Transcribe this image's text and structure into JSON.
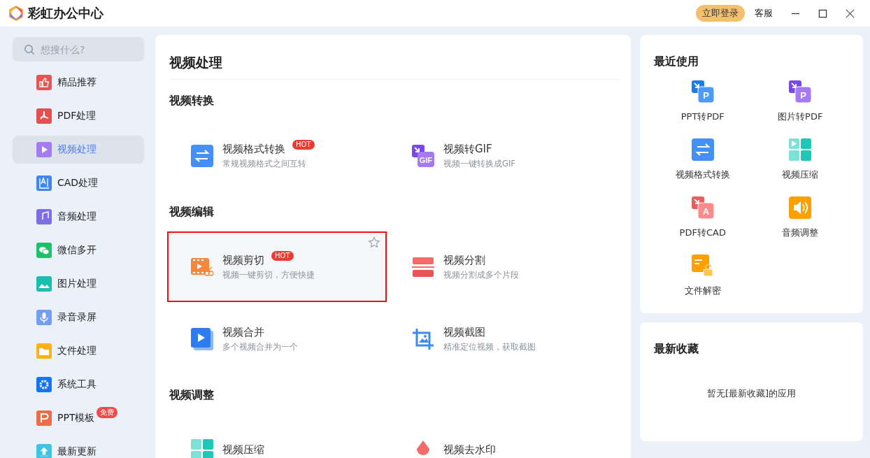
{
  "app": {
    "title": "彩虹办公中心"
  },
  "header": {
    "login": "立即登录",
    "service": "客服"
  },
  "search": {
    "placeholder": "想搜什么?"
  },
  "sidebar": {
    "items": [
      {
        "label": "精品推荐",
        "selected": false
      },
      {
        "label": "PDF处理",
        "selected": false
      },
      {
        "label": "视频处理",
        "selected": true
      },
      {
        "label": "CAD处理",
        "selected": false
      },
      {
        "label": "音频处理",
        "selected": false
      },
      {
        "label": "微信多开",
        "selected": false
      },
      {
        "label": "图片处理",
        "selected": false
      },
      {
        "label": "录音录屏",
        "selected": false
      },
      {
        "label": "文件处理",
        "selected": false
      },
      {
        "label": "系统工具",
        "selected": false
      },
      {
        "label": "PPT模板",
        "selected": false,
        "badge": "免费"
      },
      {
        "label": "最新更新",
        "selected": false
      }
    ]
  },
  "main": {
    "title": "视频处理",
    "sections": [
      {
        "title": "视频转换",
        "tools": [
          {
            "name": "视频格式转换",
            "desc": "常规视频格式之间互转",
            "badge": "HOT",
            "highlighted": false
          },
          {
            "name": "视频转GIF",
            "desc": "视频一键转换成GIF",
            "icon_label": "GIF",
            "highlighted": false
          }
        ]
      },
      {
        "title": "视频编辑",
        "tools": [
          {
            "name": "视频剪切",
            "desc": "视频一键剪切，方便快捷",
            "badge": "HOT",
            "highlighted": true
          },
          {
            "name": "视频分割",
            "desc": "视频分割成多个片段",
            "highlighted": false
          },
          {
            "name": "视频合并",
            "desc": "多个视频合并为一个",
            "highlighted": false
          },
          {
            "name": "视频截图",
            "desc": "精准定位视频，获取截图",
            "highlighted": false
          }
        ]
      },
      {
        "title": "视频调整",
        "tools": [
          {
            "name": "视频压缩",
            "highlighted": false
          },
          {
            "name": "视频去水印",
            "highlighted": false
          }
        ]
      }
    ]
  },
  "recent": {
    "title": "最近使用",
    "items": [
      {
        "label": "PPT转PDF",
        "icon_label": "P"
      },
      {
        "label": "图片转PDF",
        "icon_label": "P"
      },
      {
        "label": "视频格式转换"
      },
      {
        "label": "视频压缩"
      },
      {
        "label": "PDF转CAD",
        "icon_label": "A"
      },
      {
        "label": "音频调整"
      },
      {
        "label": "文件解密"
      }
    ]
  },
  "favorites": {
    "title": "最新收藏",
    "empty": "暂无[最新收藏]的应用"
  }
}
